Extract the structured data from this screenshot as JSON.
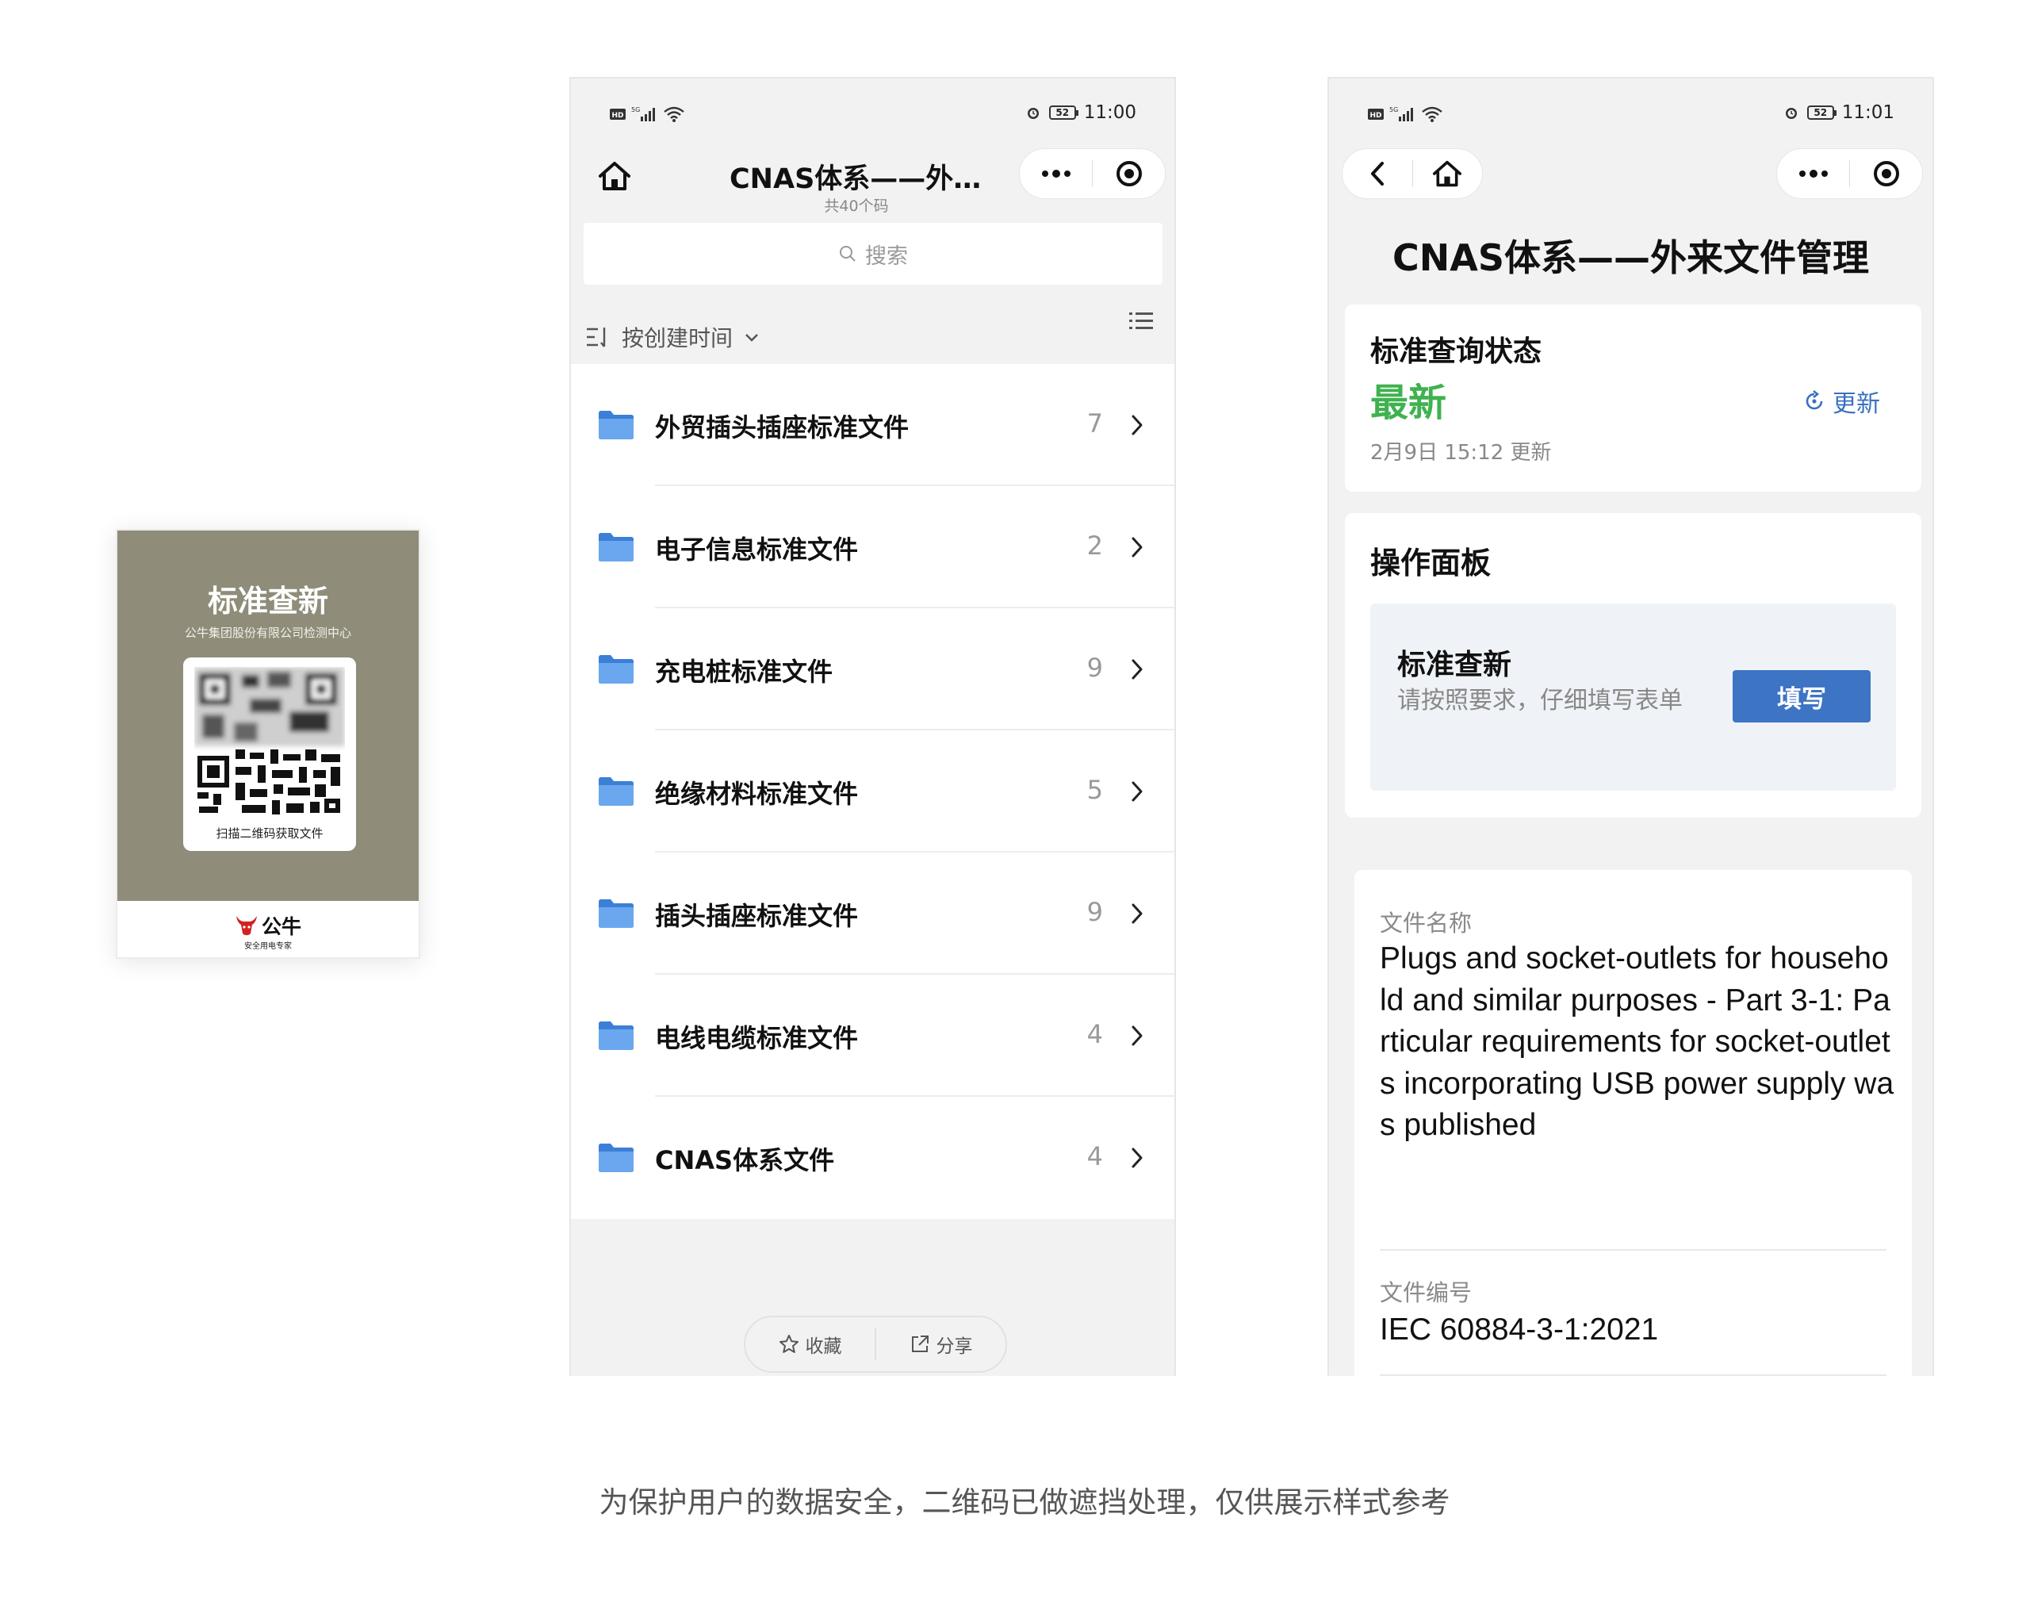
{
  "poster": {
    "title": "标准查新",
    "subtitle": "公牛集团股份有限公司检测中心",
    "qr_caption": "扫描二维码获取文件",
    "brand_name": "公牛",
    "brand_slogan": "安全用电专家"
  },
  "phone1": {
    "status": {
      "time": "11:00",
      "battery": "52"
    },
    "title": "CNAS体系——外来文件管理",
    "subtitle": "共40个码",
    "search_placeholder": "搜索",
    "sort_label": "按创建时间",
    "folders": [
      {
        "name": "外贸插头插座标准文件",
        "count": "7"
      },
      {
        "name": "电子信息标准文件",
        "count": "2"
      },
      {
        "name": "充电桩标准文件",
        "count": "9"
      },
      {
        "name": "绝缘材料标准文件",
        "count": "5"
      },
      {
        "name": "插头插座标准文件",
        "count": "9"
      },
      {
        "name": "电线电缆标准文件",
        "count": "4"
      },
      {
        "name": "CNAS体系文件",
        "count": "4"
      }
    ],
    "bottom_bar": {
      "favorite": "收藏",
      "share": "分享"
    }
  },
  "phone2": {
    "status": {
      "time": "11:01",
      "battery": "52"
    },
    "title": "CNAS体系——外来文件管理",
    "status_card": {
      "label": "标准查询状态",
      "value": "最新",
      "updated_at": "2月9日 15:12 更新",
      "update_button": "更新"
    },
    "panel": {
      "title": "操作面板",
      "task_name": "标准查新",
      "task_desc": "请按照要求，仔细填写表单",
      "fill_button": "填写"
    },
    "file": {
      "name_label": "文件名称",
      "name_value": "Plugs and socket-outlets for household and similar purposes - Part 3-1: Particular requirements for socket-outlets incorporating USB power supply was published",
      "number_label": "文件编号",
      "number_value": "IEC 60884-3-1:2021"
    }
  },
  "caption": "为保护用户的数据安全，二维码已做遮挡处理，仅供展示样式参考",
  "colors": {
    "poster_bg": "#8f8c79",
    "accent_green": "#3fb24f",
    "accent_blue": "#3d74c4",
    "folder_blue": "#4a8fe0"
  }
}
